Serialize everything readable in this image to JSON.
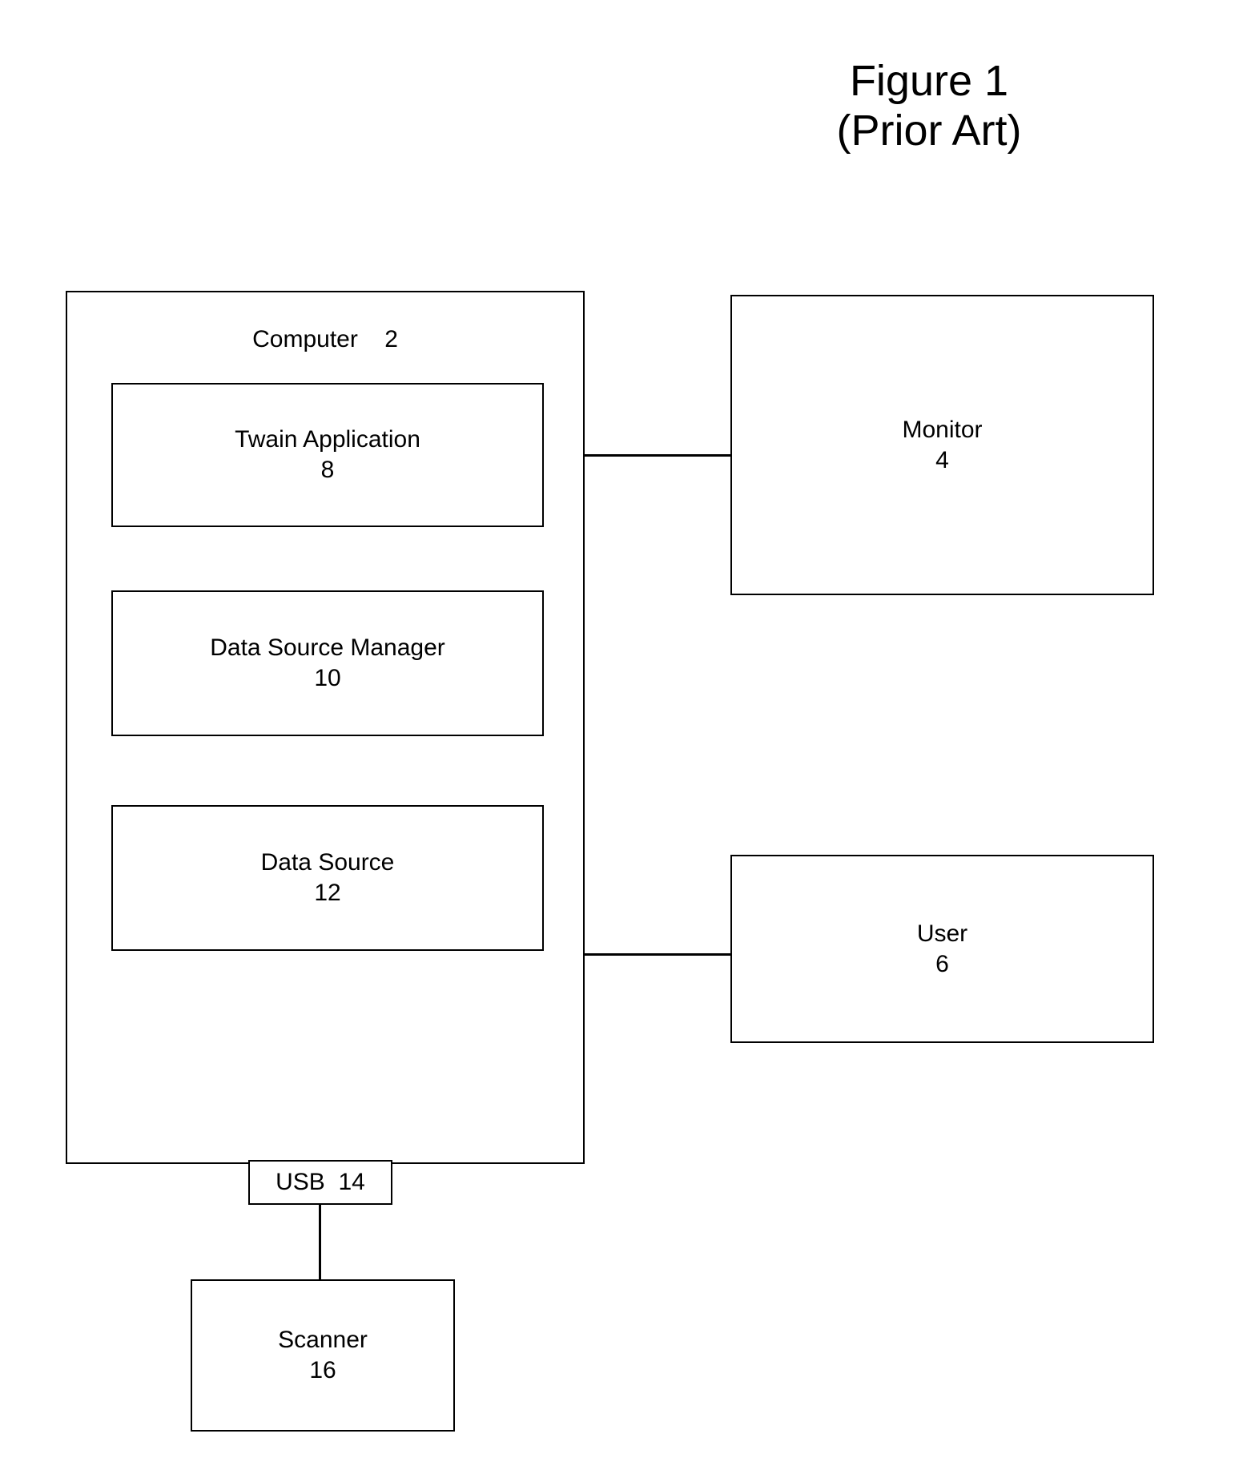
{
  "title": {
    "line1": "Figure 1",
    "line2": "(Prior Art)"
  },
  "computer": {
    "label": "Computer",
    "number": "2",
    "twain": {
      "label": "Twain Application",
      "number": "8"
    },
    "dsm": {
      "label": "Data Source Manager",
      "number": "10"
    },
    "ds": {
      "label": "Data Source",
      "number": "12"
    }
  },
  "usb": {
    "label": "USB",
    "number": "14"
  },
  "monitor": {
    "label": "Monitor",
    "number": "4"
  },
  "user": {
    "label": "User",
    "number": "6"
  },
  "scanner": {
    "label": "Scanner",
    "number": "16"
  }
}
